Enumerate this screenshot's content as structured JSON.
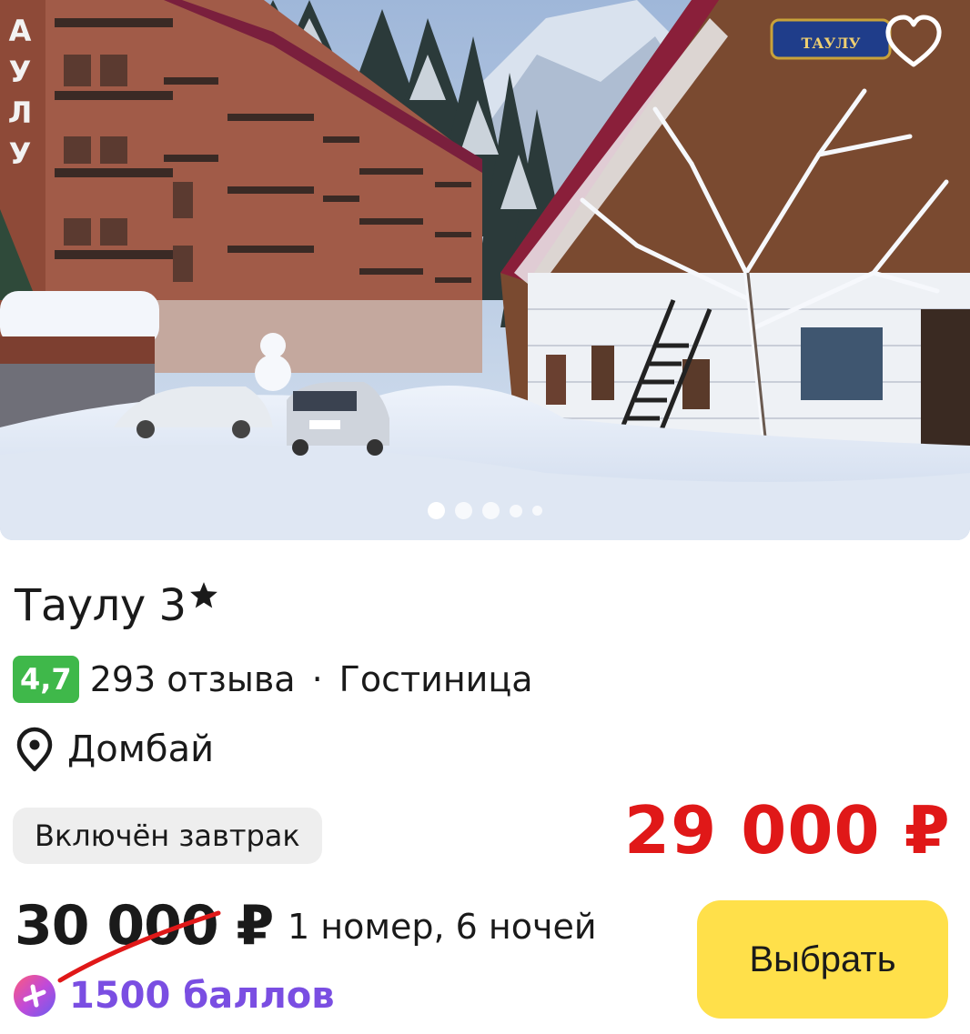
{
  "hotel": {
    "name": "Таулу 3",
    "rating": "4,7",
    "reviews": "293 отзыва",
    "separator": "·",
    "type": "Гостиница",
    "location": "Домбай",
    "building_sign": "ТАУЛУ"
  },
  "gallery": {
    "slide_count": 5,
    "active_slide": 1
  },
  "offer": {
    "badge": "Включён завтрак",
    "new_price": "29 000 ₽",
    "old_price": "30 000 ₽",
    "stay": "1 номер, 6 ночей",
    "points": "1500 баллов",
    "select_label": "Выбрать"
  },
  "icons": {
    "favorite": "heart-outline-icon",
    "star": "star-icon",
    "location": "map-pin-icon",
    "points": "plus-points-icon"
  },
  "colors": {
    "rating_bg": "#3fb84a",
    "new_price": "#e01818",
    "select_button": "#ffe04a",
    "points_text": "#7a4ee2",
    "badge_bg": "#eeeeee"
  }
}
